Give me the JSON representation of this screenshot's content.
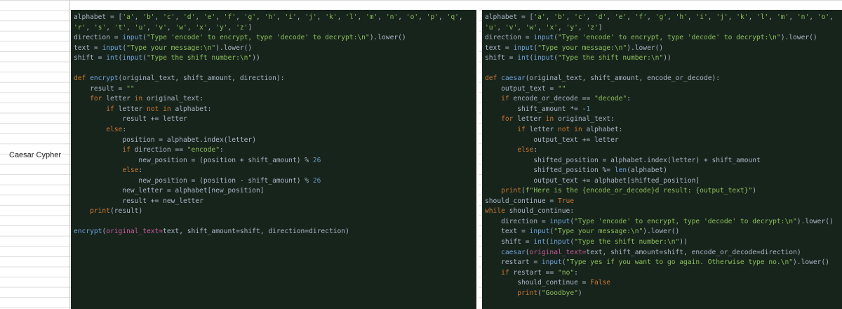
{
  "sheet": {
    "row_label": "Caesar Cypher"
  },
  "left_code": [
    "alphabet = ['a', 'b', 'c', 'd', 'e', 'f', 'g', 'h', 'i', 'j', 'k', 'l', 'm', 'n', 'o', 'p', 'q',",
    "'r', 's', 't', 'u', 'v', 'w', 'x', 'y', 'z']",
    "direction = input(\"Type 'encode' to encrypt, type 'decode' to decrypt:\\n\").lower()",
    "text = input(\"Type your message:\\n\").lower()",
    "shift = int(input(\"Type the shift number:\\n\"))",
    "",
    "def encrypt(original_text, shift_amount, direction):",
    "    result = \"\"",
    "    for letter in original_text:",
    "        if letter not in alphabet:",
    "            result += letter",
    "        else:",
    "            position = alphabet.index(letter)",
    "            if direction == \"encode\":",
    "                new_position = (position + shift_amount) % 26",
    "            else:",
    "                new_position = (position - shift_amount) % 26",
    "            new_letter = alphabet[new_position]",
    "            result += new_letter",
    "    print(result)",
    "",
    "encrypt(original_text=text, shift_amount=shift, direction=direction)"
  ],
  "right_code": [
    "alphabet = ['a', 'b', 'c', 'd', 'e', 'f', 'g', 'h', 'i', 'j', 'k', 'l', 'm', 'n', 'o',",
    "'u', 'v', 'w', 'x', 'y', 'z']",
    "direction = input(\"Type 'encode' to encrypt, type 'decode' to decrypt:\\n\").lower()",
    "text = input(\"Type your message:\\n\").lower()",
    "shift = int(input(\"Type the shift number:\\n\"))",
    "",
    "def caesar(original_text, shift_amount, encode_or_decode):",
    "    output_text = \"\"",
    "    if encode_or_decode == \"decode\":",
    "        shift_amount *= -1",
    "    for letter in original_text:",
    "        if letter not in alphabet:",
    "            output_text += letter",
    "        else:",
    "            shifted_position = alphabet.index(letter) + shift_amount",
    "            shifted_position %= len(alphabet)",
    "            output_text += alphabet[shifted_position]",
    "    print(f\"Here is the {encode_or_decode}d result: {output_text}\")",
    "should_continue = True",
    "while should_continue:",
    "    direction = input(\"Type 'encode' to encrypt, type 'decode' to decrypt:\\n\").lower()",
    "    text = input(\"Type your message:\\n\").lower()",
    "    shift = int(input(\"Type the shift number:\\n\"))",
    "    caesar(original_text=text, shift_amount=shift, encode_or_decode=direction)",
    "    restart = input(\"Type yes if you want to go again. Otherwise type no.\\n\").lower()",
    "    if restart == \"no\":",
    "        should_continue = False",
    "        print(\"Goodbye\")"
  ],
  "colors": {
    "code_background": "#17241c",
    "keyword": "#cc7832",
    "function": "#6fa3d9",
    "string": "#8fbf5a",
    "number": "#6897bb",
    "parameter": "#c85a9b"
  }
}
